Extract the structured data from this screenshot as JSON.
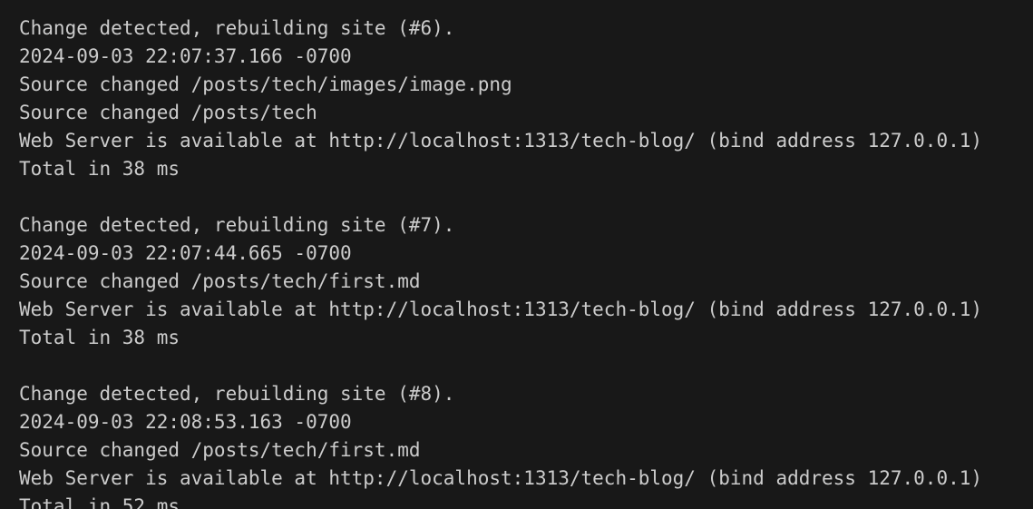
{
  "terminal": {
    "lines": [
      "Change detected, rebuilding site (#6).",
      "2024-09-03 22:07:37.166 -0700",
      "Source changed /posts/tech/images/image.png",
      "Source changed /posts/tech",
      "Web Server is available at http://localhost:1313/tech-blog/ (bind address 127.0.0.1)",
      "Total in 38 ms",
      "",
      "Change detected, rebuilding site (#7).",
      "2024-09-03 22:07:44.665 -0700",
      "Source changed /posts/tech/first.md",
      "Web Server is available at http://localhost:1313/tech-blog/ (bind address 127.0.0.1)",
      "Total in 38 ms",
      "",
      "Change detected, rebuilding site (#8).",
      "2024-09-03 22:08:53.163 -0700",
      "Source changed /posts/tech/first.md",
      "Web Server is available at http://localhost:1313/tech-blog/ (bind address 127.0.0.1)",
      "Total in 52 ms"
    ],
    "colors": {
      "background": "#181818",
      "text": "#cccccc"
    }
  }
}
